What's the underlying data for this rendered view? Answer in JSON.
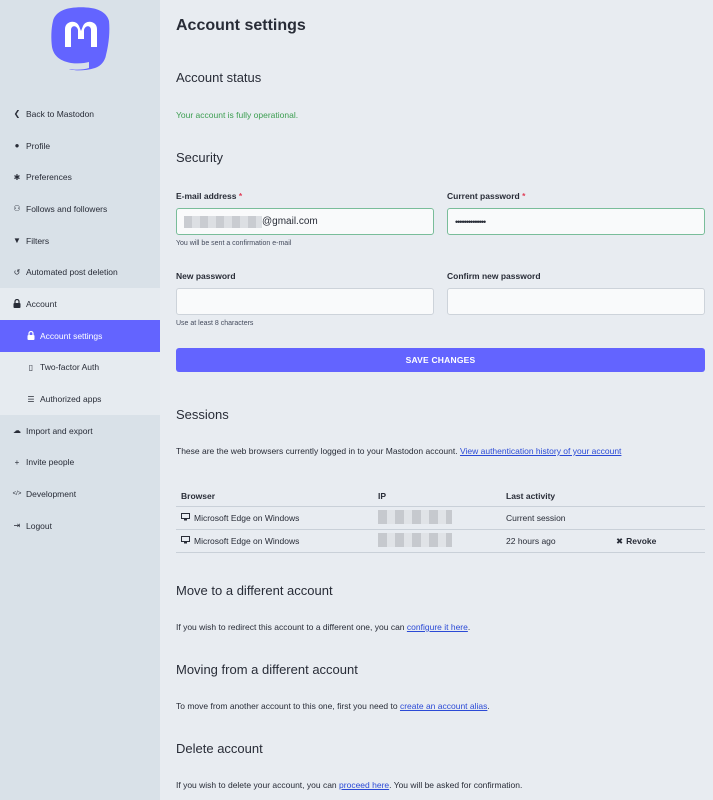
{
  "sidebar": {
    "items": [
      {
        "icon": "chevron-left-icon",
        "glyph": "❮",
        "label": "Back to Mastodon"
      },
      {
        "icon": "user-icon",
        "glyph": "●",
        "label": "Profile"
      },
      {
        "icon": "gear-icon",
        "glyph": "✱",
        "label": "Preferences"
      },
      {
        "icon": "users-icon",
        "glyph": "⚇",
        "label": "Follows and followers"
      },
      {
        "icon": "filter-icon",
        "glyph": "▼",
        "label": "Filters"
      },
      {
        "icon": "history-icon",
        "glyph": "↺",
        "label": "Automated post deletion"
      },
      {
        "icon": "lock-icon",
        "glyph": "🔒",
        "label": "Account"
      },
      {
        "icon": "lock-icon",
        "glyph": "🔒",
        "label": "Account settings"
      },
      {
        "icon": "mobile-icon",
        "glyph": "▯",
        "label": "Two-factor Auth"
      },
      {
        "icon": "list-icon",
        "glyph": "☰",
        "label": "Authorized apps"
      },
      {
        "icon": "cloud-icon",
        "glyph": "☁",
        "label": "Import and export"
      },
      {
        "icon": "user-plus-icon",
        "glyph": "+",
        "label": "Invite people"
      },
      {
        "icon": "code-icon",
        "glyph": "</>",
        "label": "Development"
      },
      {
        "icon": "sign-out-icon",
        "glyph": "⇥",
        "label": "Logout"
      }
    ]
  },
  "main": {
    "title": "Account settings",
    "status_heading": "Account status",
    "status_text": "Your account is fully operational.",
    "security_heading": "Security",
    "email_label": "E-mail address",
    "required_mark": "*",
    "email_value": "@gmail.com",
    "email_hint": "You will be sent a confirmation e-mail",
    "current_password_label": "Current password",
    "current_password_value": "••••••••••••••",
    "new_password_label": "New password",
    "new_password_hint": "Use at least 8 characters",
    "confirm_password_label": "Confirm new password",
    "save_label": "SAVE CHANGES",
    "sessions_heading": "Sessions",
    "sessions_text": "These are the web browsers currently logged in to your Mastodon account.",
    "sessions_link": "View authentication history of your account",
    "table": {
      "headers": [
        "Browser",
        "IP",
        "Last activity"
      ],
      "rows": [
        {
          "browser": "Microsoft Edge on Windows",
          "activity": "Current session",
          "action": ""
        },
        {
          "browser": "Microsoft Edge on Windows",
          "activity": "22 hours ago",
          "action": "Revoke"
        }
      ]
    },
    "move_to_heading": "Move to a different account",
    "move_to_text": "If you wish to redirect this account to a different one, you can",
    "move_to_link": "configure it here",
    "move_from_heading": "Moving from a different account",
    "move_from_text": "To move from another account to this one, first you need to",
    "move_from_link": "create an account alias",
    "delete_heading": "Delete account",
    "delete_text_pre": "If you wish to delete your account, you can",
    "delete_link": "proceed here",
    "delete_text_post": ". You will be asked for confirmation."
  },
  "colors": {
    "accent": "#6364ff",
    "success": "#3c9e51",
    "sidebar_bg": "#d9e1e8",
    "main_bg": "#e8ecf1"
  }
}
